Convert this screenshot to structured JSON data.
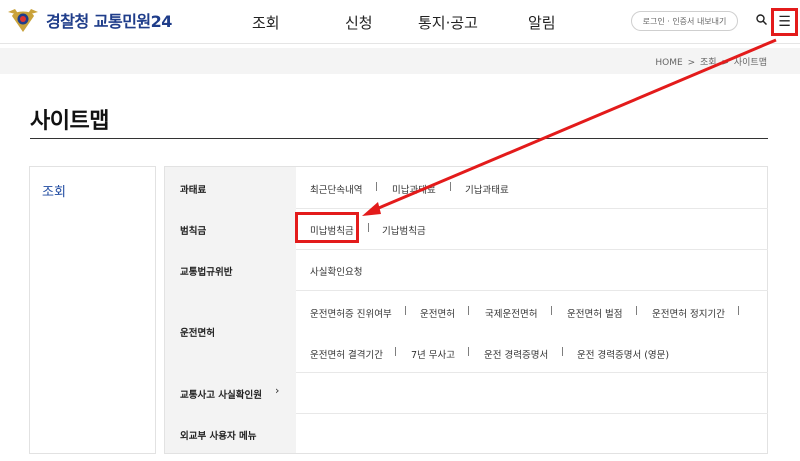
{
  "header": {
    "logo_main": "경찰청",
    "logo_sub": "교통민원24",
    "nav": [
      "조회",
      "신청",
      "통지·공고",
      "알림"
    ],
    "login_label": "로그인 · 인증서 내보내기",
    "menu_glyph": "☰"
  },
  "breadcrumb": [
    "HOME",
    "조회",
    "사이트맵"
  ],
  "page": {
    "title": "사이트맵"
  },
  "category": {
    "label": "조회"
  },
  "rows": [
    {
      "label": "과태료",
      "items": [
        "최근단속내역",
        "미납과태료",
        "기납과태료"
      ]
    },
    {
      "label": "범칙금",
      "items": [
        "미납범칙금",
        "기납범칙금"
      ]
    },
    {
      "label": "교통법규위반",
      "items": [
        "사실확인요청"
      ]
    },
    {
      "label": "운전면허",
      "items": [
        "운전면허증 진위여부",
        "운전면허",
        "국제운전면허",
        "운전면허 벌점",
        "운전면허 정지기간",
        "운전면허 결격기간",
        "7년 무사고",
        "운전 경력증명서",
        "운전 경력증명서 (영문)"
      ]
    },
    {
      "label": "교통사고 사실확인원",
      "items": []
    },
    {
      "label": "외교부 사용자 메뉴",
      "items": []
    }
  ],
  "separator": "|",
  "chevron": "›",
  "colors": {
    "brand": "#1f3d8a",
    "highlight": "#e31b1b"
  }
}
